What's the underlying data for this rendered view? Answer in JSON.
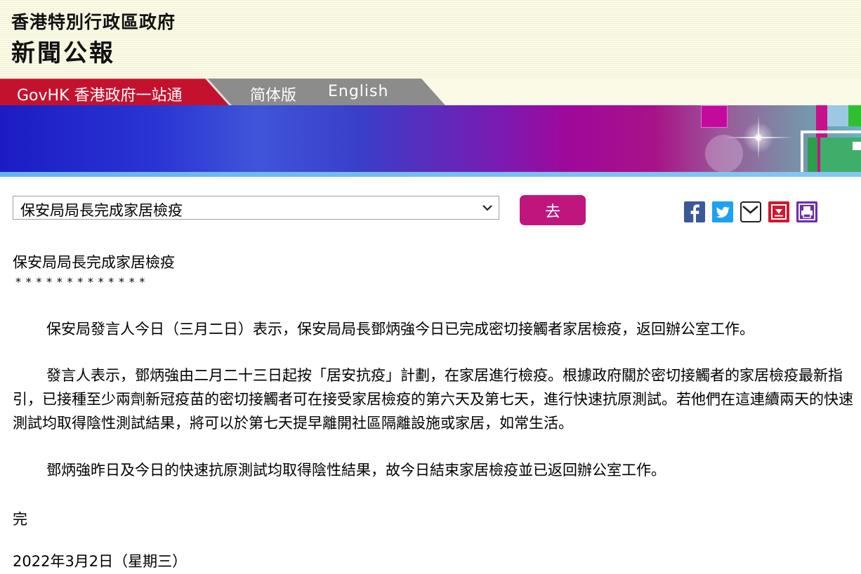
{
  "header": {
    "gov_name": "香港特別行政區政府",
    "press_title": "新聞公報"
  },
  "nav": {
    "govhk": "GovHK 香港政府一站通",
    "simplified": "简体版",
    "english": "English"
  },
  "controls": {
    "selected_item": "保安局局長完成家居檢疫",
    "go_label": "去",
    "share_icons": [
      "facebook-icon",
      "twitter-icon",
      "email-icon",
      "download-icon",
      "print-icon"
    ]
  },
  "article": {
    "title": "保安局局長完成家居檢疫",
    "stars": "*************",
    "paragraphs": [
      "保安局發言人今日（三月二日）表示，保安局局長鄧炳強今日已完成密切接觸者家居檢疫，返回辦公室工作。",
      "發言人表示，鄧炳強由二月二十三日起按「居安抗疫」計劃，在家居進行檢疫。根據政府關於密切接觸者的家居檢疫最新指引，已接種至少兩劑新冠疫苗的密切接觸者可在接受家居檢疫的第六天及第七天，進行快速抗原測試。若他們在這連續兩天的快速測試均取得陰性測試結果，將可以於第七天提早離開社區隔離設施或家居，如常生活。",
      "鄧炳強昨日及今日的快速抗原測試均取得陰性結果，故今日結束家居檢疫並已返回辦公室工作。"
    ],
    "end_mark": "完",
    "date": "2022年3月2日（星期三）"
  },
  "colors": {
    "govhk_red": "#c4122e",
    "nav_gray": "#8c8c8c",
    "go_button": "#c0157c",
    "header_bg": "#fafae6"
  }
}
